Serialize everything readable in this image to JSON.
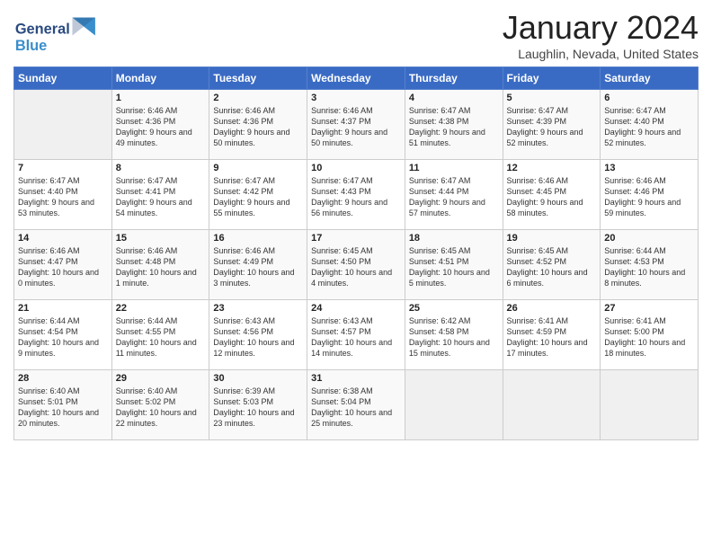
{
  "header": {
    "logo_text_general": "General",
    "logo_text_blue": "Blue",
    "month_title": "January 2024",
    "location": "Laughlin, Nevada, United States"
  },
  "days_of_week": [
    "Sunday",
    "Monday",
    "Tuesday",
    "Wednesday",
    "Thursday",
    "Friday",
    "Saturday"
  ],
  "weeks": [
    [
      {
        "day": "",
        "sunrise": "",
        "sunset": "",
        "daylight": ""
      },
      {
        "day": "1",
        "sunrise": "Sunrise: 6:46 AM",
        "sunset": "Sunset: 4:36 PM",
        "daylight": "Daylight: 9 hours and 49 minutes."
      },
      {
        "day": "2",
        "sunrise": "Sunrise: 6:46 AM",
        "sunset": "Sunset: 4:36 PM",
        "daylight": "Daylight: 9 hours and 50 minutes."
      },
      {
        "day": "3",
        "sunrise": "Sunrise: 6:46 AM",
        "sunset": "Sunset: 4:37 PM",
        "daylight": "Daylight: 9 hours and 50 minutes."
      },
      {
        "day": "4",
        "sunrise": "Sunrise: 6:47 AM",
        "sunset": "Sunset: 4:38 PM",
        "daylight": "Daylight: 9 hours and 51 minutes."
      },
      {
        "day": "5",
        "sunrise": "Sunrise: 6:47 AM",
        "sunset": "Sunset: 4:39 PM",
        "daylight": "Daylight: 9 hours and 52 minutes."
      },
      {
        "day": "6",
        "sunrise": "Sunrise: 6:47 AM",
        "sunset": "Sunset: 4:40 PM",
        "daylight": "Daylight: 9 hours and 52 minutes."
      }
    ],
    [
      {
        "day": "7",
        "sunrise": "Sunrise: 6:47 AM",
        "sunset": "Sunset: 4:40 PM",
        "daylight": "Daylight: 9 hours and 53 minutes."
      },
      {
        "day": "8",
        "sunrise": "Sunrise: 6:47 AM",
        "sunset": "Sunset: 4:41 PM",
        "daylight": "Daylight: 9 hours and 54 minutes."
      },
      {
        "day": "9",
        "sunrise": "Sunrise: 6:47 AM",
        "sunset": "Sunset: 4:42 PM",
        "daylight": "Daylight: 9 hours and 55 minutes."
      },
      {
        "day": "10",
        "sunrise": "Sunrise: 6:47 AM",
        "sunset": "Sunset: 4:43 PM",
        "daylight": "Daylight: 9 hours and 56 minutes."
      },
      {
        "day": "11",
        "sunrise": "Sunrise: 6:47 AM",
        "sunset": "Sunset: 4:44 PM",
        "daylight": "Daylight: 9 hours and 57 minutes."
      },
      {
        "day": "12",
        "sunrise": "Sunrise: 6:46 AM",
        "sunset": "Sunset: 4:45 PM",
        "daylight": "Daylight: 9 hours and 58 minutes."
      },
      {
        "day": "13",
        "sunrise": "Sunrise: 6:46 AM",
        "sunset": "Sunset: 4:46 PM",
        "daylight": "Daylight: 9 hours and 59 minutes."
      }
    ],
    [
      {
        "day": "14",
        "sunrise": "Sunrise: 6:46 AM",
        "sunset": "Sunset: 4:47 PM",
        "daylight": "Daylight: 10 hours and 0 minutes."
      },
      {
        "day": "15",
        "sunrise": "Sunrise: 6:46 AM",
        "sunset": "Sunset: 4:48 PM",
        "daylight": "Daylight: 10 hours and 1 minute."
      },
      {
        "day": "16",
        "sunrise": "Sunrise: 6:46 AM",
        "sunset": "Sunset: 4:49 PM",
        "daylight": "Daylight: 10 hours and 3 minutes."
      },
      {
        "day": "17",
        "sunrise": "Sunrise: 6:45 AM",
        "sunset": "Sunset: 4:50 PM",
        "daylight": "Daylight: 10 hours and 4 minutes."
      },
      {
        "day": "18",
        "sunrise": "Sunrise: 6:45 AM",
        "sunset": "Sunset: 4:51 PM",
        "daylight": "Daylight: 10 hours and 5 minutes."
      },
      {
        "day": "19",
        "sunrise": "Sunrise: 6:45 AM",
        "sunset": "Sunset: 4:52 PM",
        "daylight": "Daylight: 10 hours and 6 minutes."
      },
      {
        "day": "20",
        "sunrise": "Sunrise: 6:44 AM",
        "sunset": "Sunset: 4:53 PM",
        "daylight": "Daylight: 10 hours and 8 minutes."
      }
    ],
    [
      {
        "day": "21",
        "sunrise": "Sunrise: 6:44 AM",
        "sunset": "Sunset: 4:54 PM",
        "daylight": "Daylight: 10 hours and 9 minutes."
      },
      {
        "day": "22",
        "sunrise": "Sunrise: 6:44 AM",
        "sunset": "Sunset: 4:55 PM",
        "daylight": "Daylight: 10 hours and 11 minutes."
      },
      {
        "day": "23",
        "sunrise": "Sunrise: 6:43 AM",
        "sunset": "Sunset: 4:56 PM",
        "daylight": "Daylight: 10 hours and 12 minutes."
      },
      {
        "day": "24",
        "sunrise": "Sunrise: 6:43 AM",
        "sunset": "Sunset: 4:57 PM",
        "daylight": "Daylight: 10 hours and 14 minutes."
      },
      {
        "day": "25",
        "sunrise": "Sunrise: 6:42 AM",
        "sunset": "Sunset: 4:58 PM",
        "daylight": "Daylight: 10 hours and 15 minutes."
      },
      {
        "day": "26",
        "sunrise": "Sunrise: 6:41 AM",
        "sunset": "Sunset: 4:59 PM",
        "daylight": "Daylight: 10 hours and 17 minutes."
      },
      {
        "day": "27",
        "sunrise": "Sunrise: 6:41 AM",
        "sunset": "Sunset: 5:00 PM",
        "daylight": "Daylight: 10 hours and 18 minutes."
      }
    ],
    [
      {
        "day": "28",
        "sunrise": "Sunrise: 6:40 AM",
        "sunset": "Sunset: 5:01 PM",
        "daylight": "Daylight: 10 hours and 20 minutes."
      },
      {
        "day": "29",
        "sunrise": "Sunrise: 6:40 AM",
        "sunset": "Sunset: 5:02 PM",
        "daylight": "Daylight: 10 hours and 22 minutes."
      },
      {
        "day": "30",
        "sunrise": "Sunrise: 6:39 AM",
        "sunset": "Sunset: 5:03 PM",
        "daylight": "Daylight: 10 hours and 23 minutes."
      },
      {
        "day": "31",
        "sunrise": "Sunrise: 6:38 AM",
        "sunset": "Sunset: 5:04 PM",
        "daylight": "Daylight: 10 hours and 25 minutes."
      },
      {
        "day": "",
        "sunrise": "",
        "sunset": "",
        "daylight": ""
      },
      {
        "day": "",
        "sunrise": "",
        "sunset": "",
        "daylight": ""
      },
      {
        "day": "",
        "sunrise": "",
        "sunset": "",
        "daylight": ""
      }
    ]
  ]
}
